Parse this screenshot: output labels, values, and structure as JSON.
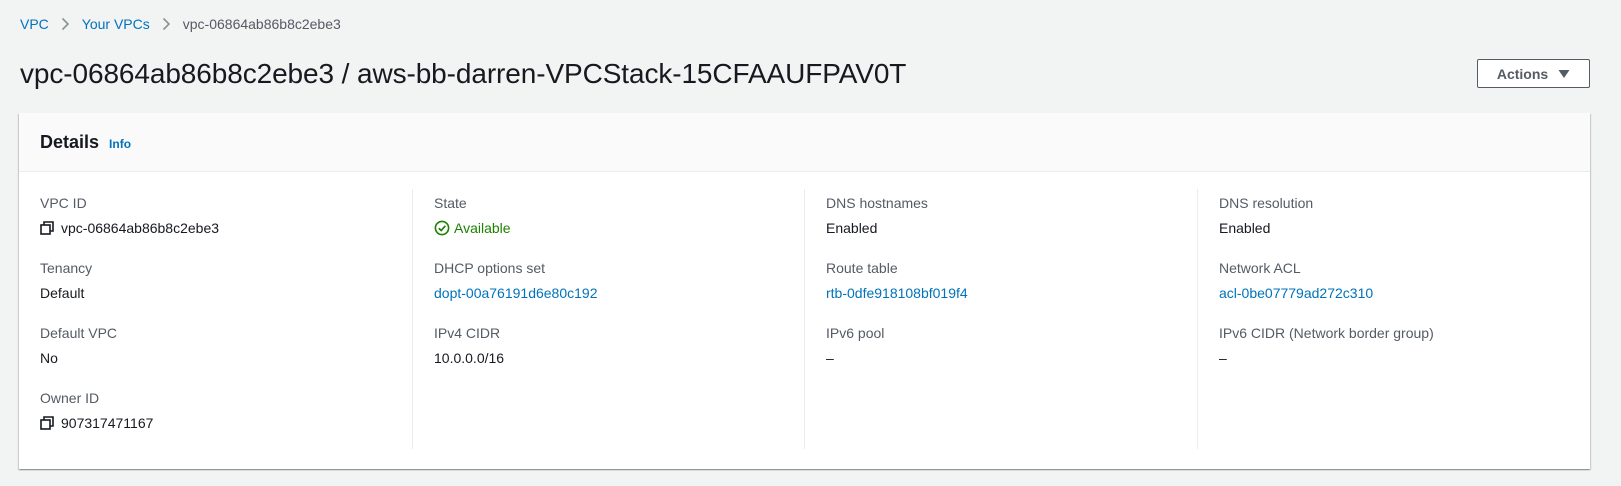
{
  "breadcrumb": {
    "items": [
      {
        "label": "VPC"
      },
      {
        "label": "Your VPCs"
      },
      {
        "label": "vpc-06864ab86b8c2ebe3"
      }
    ]
  },
  "header": {
    "title": "vpc-06864ab86b8c2ebe3 / aws-bb-darren-VPCStack-15CFAAUFPAV0T",
    "actions_label": "Actions"
  },
  "details": {
    "title": "Details",
    "info_label": "Info",
    "columns": [
      [
        {
          "label": "VPC ID",
          "value": "vpc-06864ab86b8c2ebe3",
          "copyable": true
        },
        {
          "label": "Tenancy",
          "value": "Default"
        },
        {
          "label": "Default VPC",
          "value": "No"
        },
        {
          "label": "Owner ID",
          "value": "907317471167",
          "copyable": true
        }
      ],
      [
        {
          "label": "State",
          "value": "Available",
          "status": "success"
        },
        {
          "label": "DHCP options set",
          "value": "dopt-00a76191d6e80c192",
          "link": true
        },
        {
          "label": "IPv4 CIDR",
          "value": "10.0.0.0/16"
        }
      ],
      [
        {
          "label": "DNS hostnames",
          "value": "Enabled"
        },
        {
          "label": "Route table",
          "value": "rtb-0dfe918108bf019f4",
          "link": true
        },
        {
          "label": "IPv6 pool",
          "value": "–"
        }
      ],
      [
        {
          "label": "DNS resolution",
          "value": "Enabled"
        },
        {
          "label": "Network ACL",
          "value": "acl-0be07779ad272c310",
          "link": true
        },
        {
          "label": "IPv6 CIDR (Network border group)",
          "value": "–"
        }
      ]
    ]
  },
  "colors": {
    "link": "#0073bb",
    "success": "#1d8102",
    "label": "#545b64",
    "text": "#16191f",
    "background": "#f2f3f3"
  },
  "icons": {
    "breadcrumb_separator": "chevron-right-icon",
    "actions_caret": "caret-down-icon",
    "copy": "copy-icon",
    "status_available": "check-circle-icon"
  }
}
